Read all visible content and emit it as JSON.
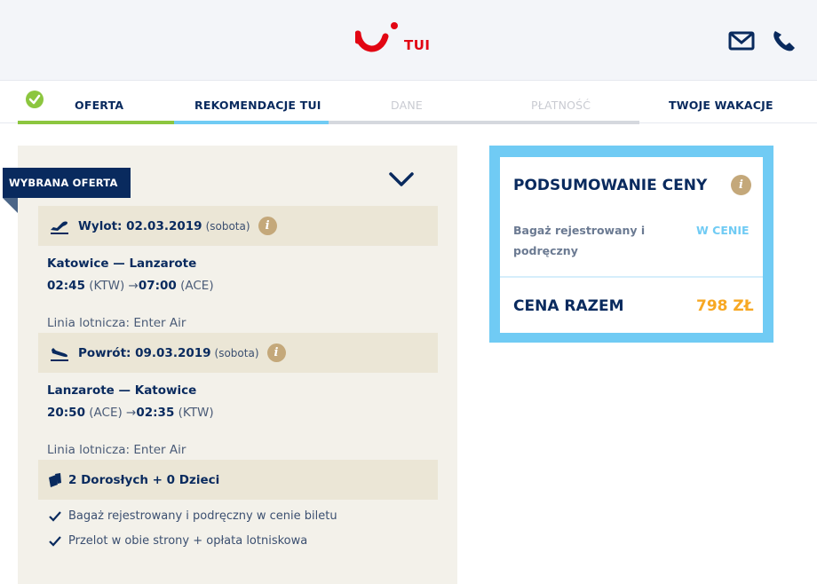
{
  "header": {
    "brand": "TUI",
    "mail_icon": "mail-icon",
    "phone_icon": "phone-icon",
    "brand_color": "#e20613",
    "background": "#f3f5f9"
  },
  "steps": [
    {
      "label": "OFERTA",
      "state": "done",
      "bar_color": "#8cc63f"
    },
    {
      "label": "REKOMENDACJE TUI",
      "state": "current",
      "bar_color": "#70cbf4"
    },
    {
      "label": "DANE",
      "state": "disabled",
      "bar_color": "#d5d8de"
    },
    {
      "label": "PŁATNOŚĆ",
      "state": "disabled",
      "bar_color": "#d5d8de"
    },
    {
      "label": "TWOJE WAKACJE",
      "state": "upcoming"
    }
  ],
  "offer": {
    "ribbon": "WYBRANA OFERTA",
    "outbound": {
      "heading": "Wylot: 02.03.2019",
      "day": "(sobota)",
      "route": "Katowice — Lanzarote",
      "dep_time": "02:45",
      "dep_code": "(KTW) →",
      "arr_time": "07:00",
      "arr_code": "(ACE)",
      "airline": "Linia lotnicza: Enter Air"
    },
    "return": {
      "heading": "Powrót: 09.03.2019",
      "day": "(sobota)",
      "route": "Lanzarote — Katowice",
      "dep_time": "20:50",
      "dep_code": "(ACE) →",
      "arr_time": "02:35",
      "arr_code": "(KTW)",
      "airline": "Linia lotnicza: Enter Air"
    },
    "passengers": "2 Dorosłych + 0 Dzieci",
    "includes": [
      "Bagaż rejestrowany i podręczny w cenie biletu",
      "Przelot w obie strony + opłata lotniskowa"
    ]
  },
  "summary": {
    "title": "PODSUMOWANIE CENY",
    "baggage_label": "Bagaż rejestrowany i podręczny",
    "baggage_value": "W CENIE",
    "total_label": "CENA RAZEM",
    "total_value": "798 ZŁ",
    "accent": "#70cbf4",
    "price_color": "#f7a823"
  }
}
